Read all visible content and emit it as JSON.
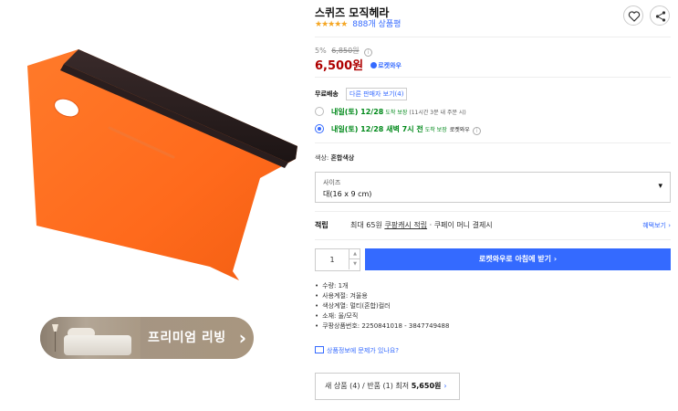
{
  "product": {
    "title": "스퀴즈 모직헤라",
    "stars": "★★★★★",
    "review_count": "888개 상품평"
  },
  "pricing": {
    "discount": "5%",
    "original_price": "6,850원",
    "price": "6,500원",
    "rocket_label": "로켓와우",
    "info_glyph": "i"
  },
  "shipping": {
    "label": "무료배송",
    "other_sellers": "다른 판매자 보기(4)",
    "options": [
      {
        "arrival": "내일(토) 12/28",
        "guarantee": "도착 보장",
        "note": "(11시간 3분 내 주문 시)",
        "rocket": ""
      },
      {
        "arrival": "내일(토) 12/28 새벽 7시 전",
        "guarantee": "도착 보장",
        "note": "",
        "rocket": "로켓와우"
      }
    ]
  },
  "color": {
    "label": "색상:",
    "value": "혼합색상"
  },
  "size": {
    "label": "사이즈",
    "value": "대(16 x 9 cm)"
  },
  "reward": {
    "label": "적립",
    "prefix": "최대 65원",
    "link": "쿠팡캐시 적립",
    "suffix": "· 쿠페이 머니 결제시",
    "more": "혜택보기 ›"
  },
  "purchase": {
    "quantity": "1",
    "buy_label": "로켓와우로 아침에 받기  ›"
  },
  "specs": [
    "수량: 1개",
    "사용계절: 겨울용",
    "색상계열: 멀티(혼합)컬러",
    "소재: 울/모직",
    "쿠팡상품번호: 2250841018 - 3847749488"
  ],
  "report": {
    "label": "상품정보에 문제가 있나요?"
  },
  "sellers": {
    "new": "새 상품 (4)",
    "sep": " / ",
    "used": "반품 (1)",
    "min_prefix": " 최저 ",
    "min_price": "5,650원",
    "chevron": "›"
  },
  "banner": {
    "text": "프리미엄 리빙",
    "chevron": "›"
  },
  "colors": {
    "accent": "#346aff",
    "price": "#ae0000",
    "arrival": "#00891a",
    "product_orange": "#ff6a1f"
  }
}
